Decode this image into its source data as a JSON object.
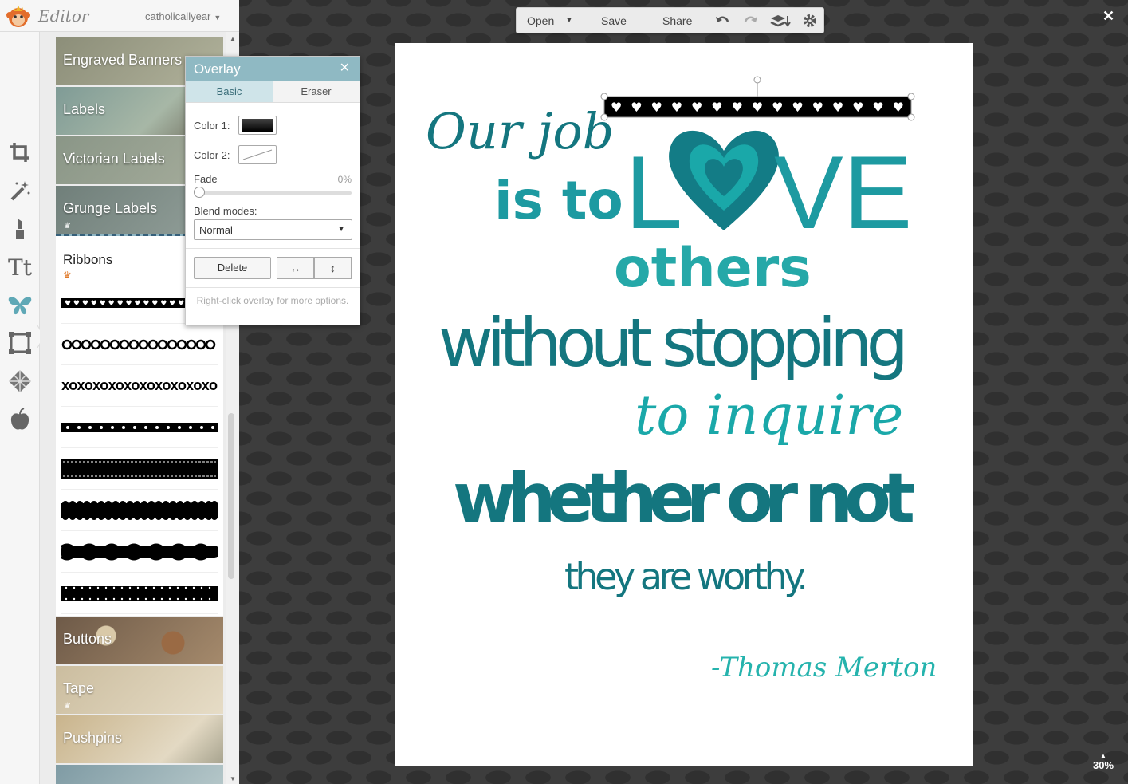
{
  "app": {
    "name": "Editor",
    "user": "catholicallyear"
  },
  "toolbar": {
    "open": "Open",
    "save": "Save",
    "share": "Share"
  },
  "categories": [
    {
      "label": "Engraved Banners",
      "bg": "#9a9c88"
    },
    {
      "label": "Labels",
      "bg": "#8fa7a2"
    },
    {
      "label": "Victorian Labels",
      "bg": "#8f9a8a"
    },
    {
      "label": "Grunge Labels",
      "bg": "#7b8a84"
    },
    {
      "label": "Buttons",
      "bg": "#8a7560"
    },
    {
      "label": "Tape",
      "bg": "#d9cdb6"
    },
    {
      "label": "Pushpins",
      "bg": "#b8b09a"
    }
  ],
  "ribbons": {
    "title": "Ribbons",
    "count": 8
  },
  "overlay": {
    "title": "Overlay",
    "tabs": [
      "Basic",
      "Eraser"
    ],
    "color1_label": "Color 1:",
    "color2_label": "Color 2:",
    "fade_label": "Fade",
    "fade_value": "0%",
    "blend_label": "Blend modes:",
    "blend_value": "Normal",
    "delete_label": "Delete",
    "note": "Right-click overlay for more options."
  },
  "quote": {
    "line1": "Our job",
    "line2a": "is to",
    "line2b": "L",
    "line2c": "VE",
    "line3": "others",
    "line4": "without  stopping",
    "line5": "to inquire",
    "line6": "whether or not",
    "line7": "they are worthy.",
    "author": "-Thomas Merton"
  },
  "colors": {
    "teal_dark": "#14767f",
    "teal_mid": "#1d9aa1",
    "teal_light": "#25b3ad",
    "heart_outer": "#137c86",
    "heart_inner": "#1aa8a9"
  },
  "zoom": "30%"
}
